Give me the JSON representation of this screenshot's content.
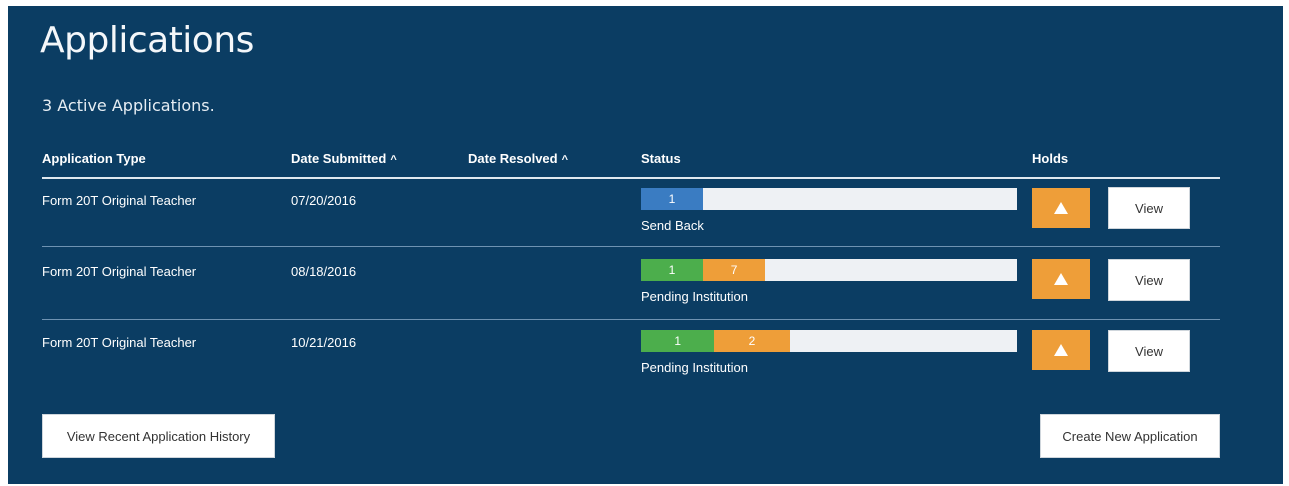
{
  "page": {
    "title": "Applications",
    "active_count_text": "3 Active Applications."
  },
  "table": {
    "headers": {
      "application_type": "Application Type",
      "date_submitted": "Date Submitted",
      "date_resolved": "Date Resolved",
      "status": "Status",
      "holds": "Holds",
      "sort_glyph": "^"
    },
    "rows": [
      {
        "application_type": "Form 20T Original Teacher",
        "date_submitted": "07/20/2016",
        "date_resolved": "",
        "status_label": "Send Back",
        "segments": [
          {
            "label": "1",
            "color": "blue",
            "fraction": 0.165
          }
        ],
        "hold_icon": "warning-triangle-icon",
        "view_label": "View"
      },
      {
        "application_type": "Form 20T Original Teacher",
        "date_submitted": "08/18/2016",
        "date_resolved": "",
        "status_label": "Pending Institution",
        "segments": [
          {
            "label": "1",
            "color": "green",
            "fraction": 0.165
          },
          {
            "label": "7",
            "color": "orange",
            "fraction": 0.165
          }
        ],
        "hold_icon": "warning-triangle-icon",
        "view_label": "View"
      },
      {
        "application_type": "Form 20T Original Teacher",
        "date_submitted": "10/21/2016",
        "date_resolved": "",
        "status_label": "Pending Institution",
        "segments": [
          {
            "label": "1",
            "color": "green",
            "fraction": 0.195
          },
          {
            "label": "2",
            "color": "orange",
            "fraction": 0.2
          }
        ],
        "hold_icon": "warning-triangle-icon",
        "view_label": "View"
      }
    ]
  },
  "footer": {
    "history_button": "View Recent Application History",
    "create_button": "Create New Application"
  },
  "colors": {
    "panel_bg": "#0b3d63",
    "blue": "#3a7cc2",
    "green": "#4cae4c",
    "orange": "#ee9e39",
    "bar_empty": "#eef1f4"
  }
}
